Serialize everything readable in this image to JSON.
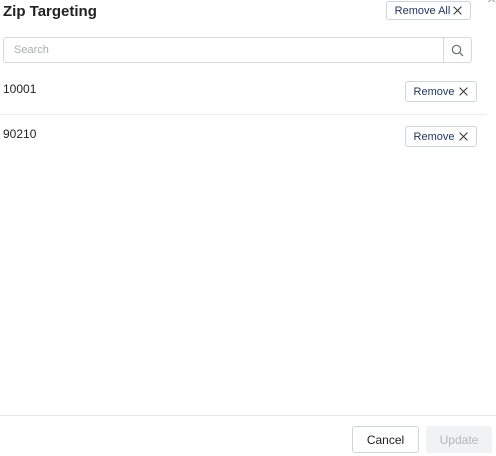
{
  "dialog": {
    "title": "Zip Targeting",
    "remove_all_label": "Remove All"
  },
  "search": {
    "placeholder": "Search",
    "value": ""
  },
  "zips": [
    {
      "code": "10001",
      "remove_label": "Remove"
    },
    {
      "code": "90210",
      "remove_label": "Remove"
    }
  ],
  "footer": {
    "cancel_label": "Cancel",
    "update_label": "Update",
    "update_enabled": false
  },
  "icons": {
    "search": "search-icon",
    "remove": "close-icon"
  },
  "colors": {
    "button_text": "#1d3557",
    "border": "#cfd4da",
    "disabled_bg": "#f1f2f4",
    "disabled_text": "#b3b7bc"
  }
}
